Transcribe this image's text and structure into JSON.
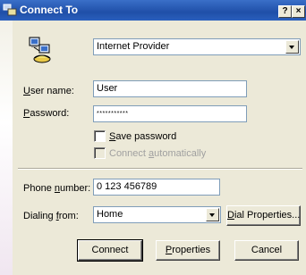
{
  "window": {
    "title": "Connect To",
    "help_button": "?",
    "close_button": "×"
  },
  "connection": {
    "selected": "Internet Provider"
  },
  "user_name": {
    "label_prefix": "",
    "label_accel": "U",
    "label_rest": "ser name:",
    "value": "User"
  },
  "password": {
    "label_accel": "P",
    "label_rest": "assword:",
    "value": "***********"
  },
  "save_password": {
    "label_accel": "S",
    "label_rest": "ave password",
    "checked": false
  },
  "connect_auto": {
    "label_a": "Connect ",
    "label_accel": "a",
    "label_rest": "utomatically",
    "checked": false,
    "enabled": false
  },
  "phone": {
    "label_a": "Phone ",
    "label_accel": "n",
    "label_rest": "umber:",
    "value": "0 123 456789"
  },
  "dialing_from": {
    "label_a": "Dialing ",
    "label_accel": "f",
    "label_rest": "rom:",
    "selected": "Home"
  },
  "buttons": {
    "dial_properties": {
      "accel": "D",
      "rest": "ial Properties..."
    },
    "connect": "Connect",
    "properties": {
      "accel": "P",
      "rest": "roperties"
    },
    "cancel": "Cancel"
  },
  "icons": {
    "app": "dialup-connection-icon",
    "connection": "network-phone-icon"
  }
}
